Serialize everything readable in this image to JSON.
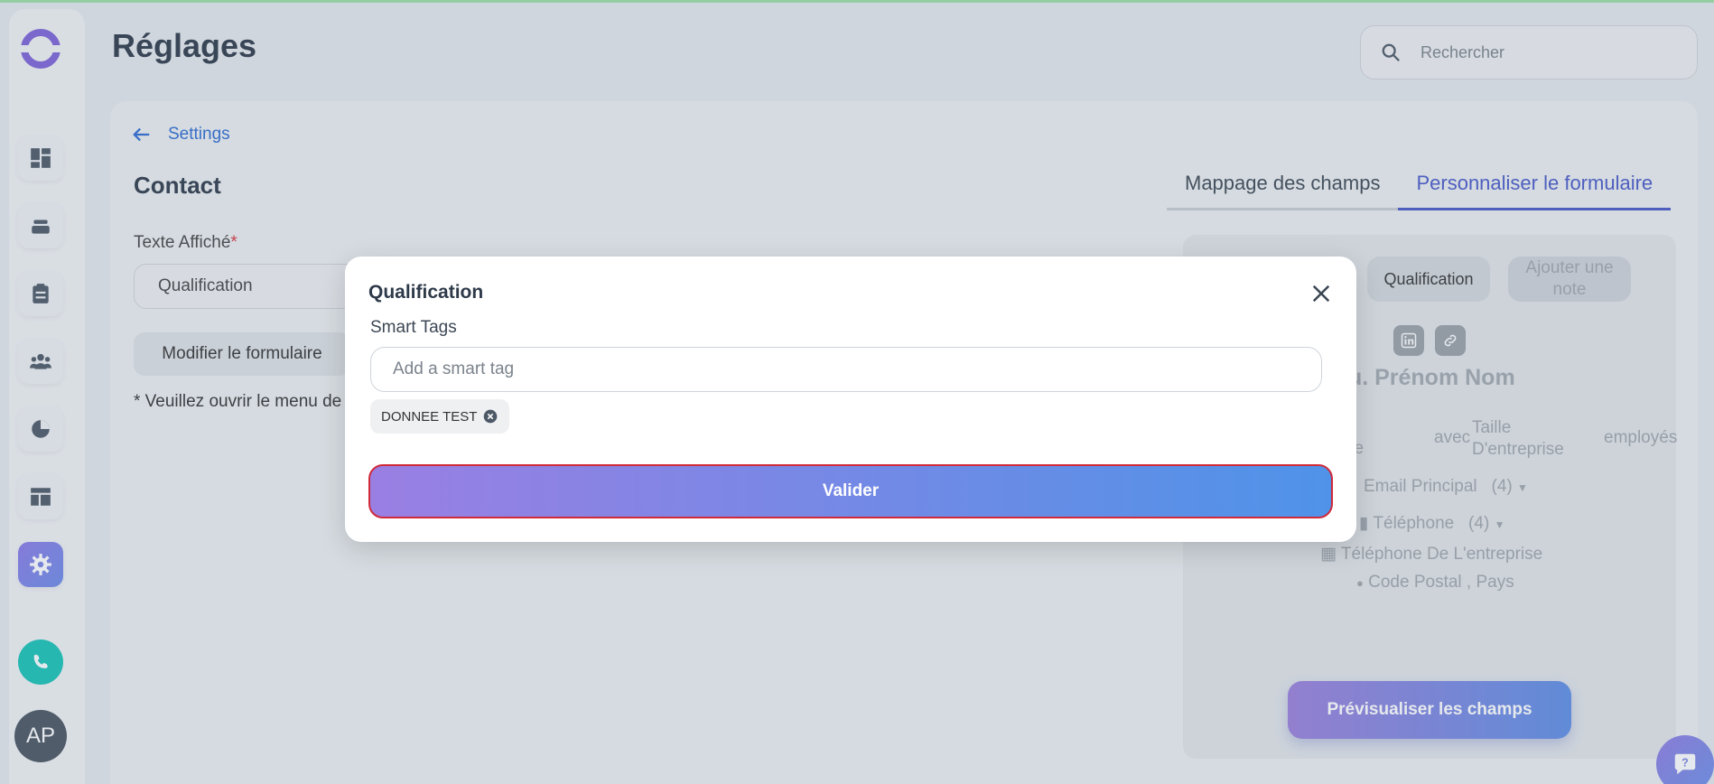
{
  "app": {
    "page_title": "Réglages",
    "search_placeholder": "Rechercher",
    "avatar_initials": "AP"
  },
  "sidebar": {
    "items": [
      {
        "name": "dashboard",
        "icon": "dashboard-icon"
      },
      {
        "name": "inbox",
        "icon": "inbox-icon"
      },
      {
        "name": "tasks",
        "icon": "clipboard-icon"
      },
      {
        "name": "contacts",
        "icon": "people-icon"
      },
      {
        "name": "reports",
        "icon": "pie-chart-icon"
      },
      {
        "name": "layout",
        "icon": "layout-icon"
      },
      {
        "name": "settings",
        "icon": "gear-icon",
        "active": true
      }
    ],
    "phone_icon": "phone-icon"
  },
  "main": {
    "back_label": "Settings",
    "section_title": "Contact",
    "field_label": "Texte Affiché",
    "required_mark": "*",
    "field_value": "Qualification",
    "modify_button": "Modifier le formulaire",
    "note_text": "* Veuillez ouvrir le menu de p",
    "tabs": [
      {
        "label": "Mappage des champs",
        "active": false
      },
      {
        "label": "Personnaliser le formulaire",
        "active": true
      }
    ]
  },
  "preview": {
    "qualification_pill": "Qualification",
    "add_note_pill": "Ajouter une note",
    "name_text": "lu. Prénom Nom",
    "company_fragment": "se",
    "with_text": "avec",
    "company_size": "Taille D'entreprise",
    "employees_text": "employés",
    "email_text": "Email Principal",
    "email_count": "(4)",
    "phone_text": "Téléphone",
    "phone_count": "(4)",
    "company_phone_text": "Téléphone De L'entreprise",
    "postal_text": "Code Postal",
    "country_text": "Pays",
    "preview_button": "Prévisualiser les champs"
  },
  "modal": {
    "title": "Qualification",
    "smart_tags_label": "Smart Tags",
    "smart_tag_placeholder": "Add a smart tag",
    "tags": [
      "DONNEE TEST"
    ],
    "submit_label": "Valider"
  },
  "colors": {
    "accent": "#4758c8",
    "link": "#2c6bd3",
    "submit_gradient_start": "#9a7fe3",
    "submit_gradient_end": "#4f93e8",
    "required": "#d9363e"
  }
}
